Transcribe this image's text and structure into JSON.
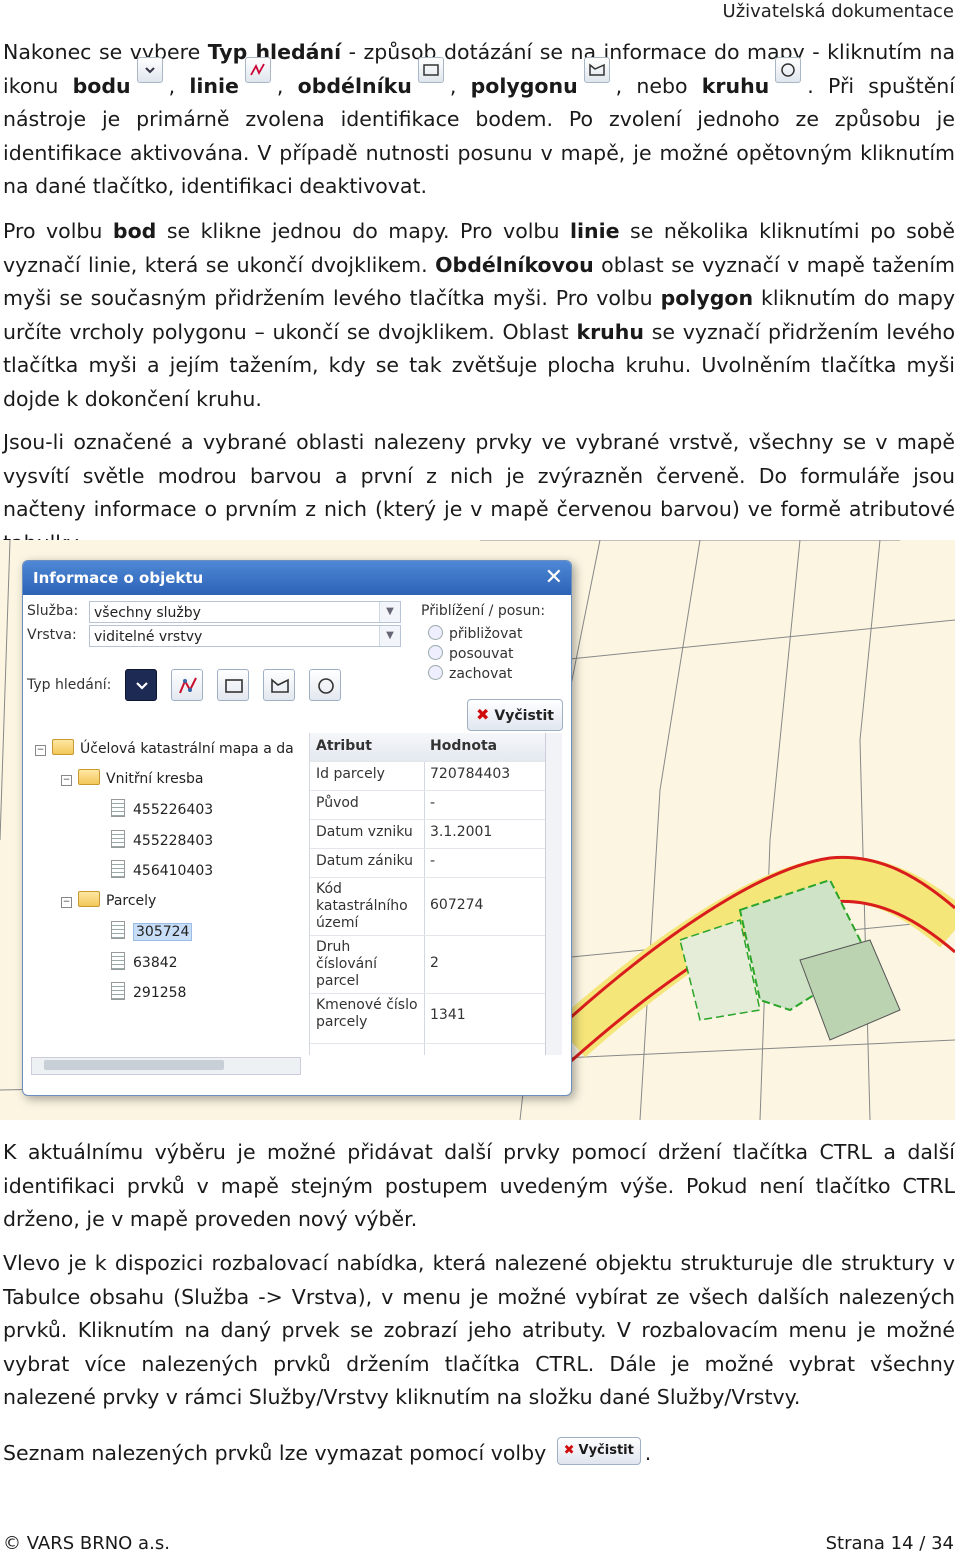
{
  "header": {
    "title": "Uživatelská dokumentace"
  },
  "paragraph1": {
    "t1": "Nakonec se vybere ",
    "b1": "Typ hledání",
    "t2": " - způsob dotázání se na informace do mapy - kliknutím na ikonu ",
    "b2": "bodu",
    "t3": ", ",
    "b3": "linie",
    "t4": ", ",
    "b4": "obdélníku",
    "t5": ", ",
    "b5": "polygonu",
    "t6": ", nebo ",
    "b6": "kruhu",
    "t7": ". Při spuštění nástroje je primárně zvolena identifikace bodem. Po zvolení jednoho ze způsobu je identifikace aktivována. V případě nutnosti posunu v mapě, je možné opětovným kliknutím na dané tlačítko, identifikaci deaktivovat."
  },
  "paragraph2": {
    "t1": "Pro volbu ",
    "b1": "bod",
    "t2": " se klikne jednou do mapy. Pro volbu ",
    "b2": "linie",
    "t3": " se několika kliknutími po sobě vyznačí linie, která se ukončí dvojklikem. ",
    "b3": "Obdélníkovou",
    "t4": " oblast se vyznačí v mapě tažením myši se současným přidržením levého tlačítka myši. Pro volbu ",
    "b4": "polygon",
    "t5": " kliknutím do mapy určíte vrcholy polygonu – ukončí se dvojklikem. Oblast ",
    "b5": "kruhu",
    "t6": " se vyznačí přidržením levého tlačítka myši a jejím tažením, kdy se tak zvětšuje plocha kruhu. Uvolněním tlačítka myši dojde k dokončení kruhu."
  },
  "paragraph3": "Jsou-li označené a vybrané oblasti nalezeny prvky ve vybrané vrstvě, všechny se v mapě vysvítí světle modrou barvou a první z nich je zvýrazněn červeně. Do formuláře jsou načteny informace o prvním z nich (který je v mapě červenou barvou) ve formě atributové tabulky.",
  "dialog": {
    "title": "Informace o objektu",
    "sluzba_label": "Služba:",
    "sluzba_value": "všechny služby",
    "vrstva_label": "Vrstva:",
    "vrstva_value": "viditelné vrstvy",
    "typ_label": "Typ hledání:",
    "zoom_label": "Přiblížení / posun:",
    "radio1": "přibližovat",
    "radio2": "posouvat",
    "radio3": "zachovat",
    "clear_label": "Vyčistit",
    "tree": {
      "root": "Účelová katastrální mapa a da",
      "group1": "Vnitřní kresba",
      "g1_items": [
        "455226403",
        "455228403",
        "456410403"
      ],
      "group2": "Parcely",
      "g2_items": [
        "305724",
        "63842",
        "291258"
      ]
    },
    "attr_head": {
      "key": "Atribut",
      "value": "Hodnota"
    },
    "attrs": [
      {
        "key": "Id parcely",
        "value": "720784403"
      },
      {
        "key": "Původ",
        "value": "-"
      },
      {
        "key": "Datum vzniku",
        "value": "3.1.2001"
      },
      {
        "key": "Datum zániku",
        "value": "-"
      },
      {
        "key": "Kód katastrálního území",
        "value": "607274"
      },
      {
        "key": "Druh číslování parcel",
        "value": "2"
      },
      {
        "key": "Kmenové číslo parcely",
        "value": "1341"
      }
    ]
  },
  "paragraph4": "K aktuálnímu výběru je možné přidávat další prvky pomocí držení tlačítka CTRL a další identifikaci prvků v mapě stejným postupem uvedeným výše. Pokud není tlačítko CTRL drženo, je v mapě proveden nový výběr.",
  "paragraph5": "Vlevo je k dispozici rozbalovací nabídka, která nalezené objektu strukturuje dle struktury v Tabulce obsahu (Služba -> Vrstva), v menu je možné vybírat ze všech dalších nalezených prvků. Kliknutím na daný prvek se zobrazí jeho atributy. V rozbalovacím menu je možné vybrat více nalezených prvků držením tlačítka CTRL. Dále je možné vybrat všechny nalezené prvky v rámci Služby/Vrstvy kliknutím na složku dané Služby/Vrstvy.",
  "paragraph6": {
    "t1": "Seznam nalezených prvků lze vymazat pomocí volby ",
    "btn": "Vyčistit",
    "t2": "."
  },
  "footer": {
    "left": "© VARS BRNO a.s.",
    "right": "Strana 14 / 34"
  }
}
